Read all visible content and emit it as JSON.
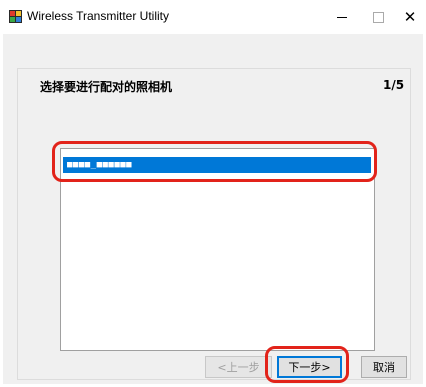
{
  "window": {
    "title": "Wireless Transmitter Utility",
    "controls": {
      "minimize": "—",
      "maximize": "□",
      "close": "✕"
    }
  },
  "wizard": {
    "heading": "选择要进行配对的照相机",
    "step": "1/5",
    "camera_list": [
      {
        "label": "■■■■_■■■■■■",
        "selected": true
      }
    ]
  },
  "buttons": {
    "back_label": "<上一步",
    "next_label": "下一步>",
    "cancel_label": "取消"
  },
  "colors": {
    "selection": "#0078d7",
    "highlight_ring": "#e2231a"
  }
}
